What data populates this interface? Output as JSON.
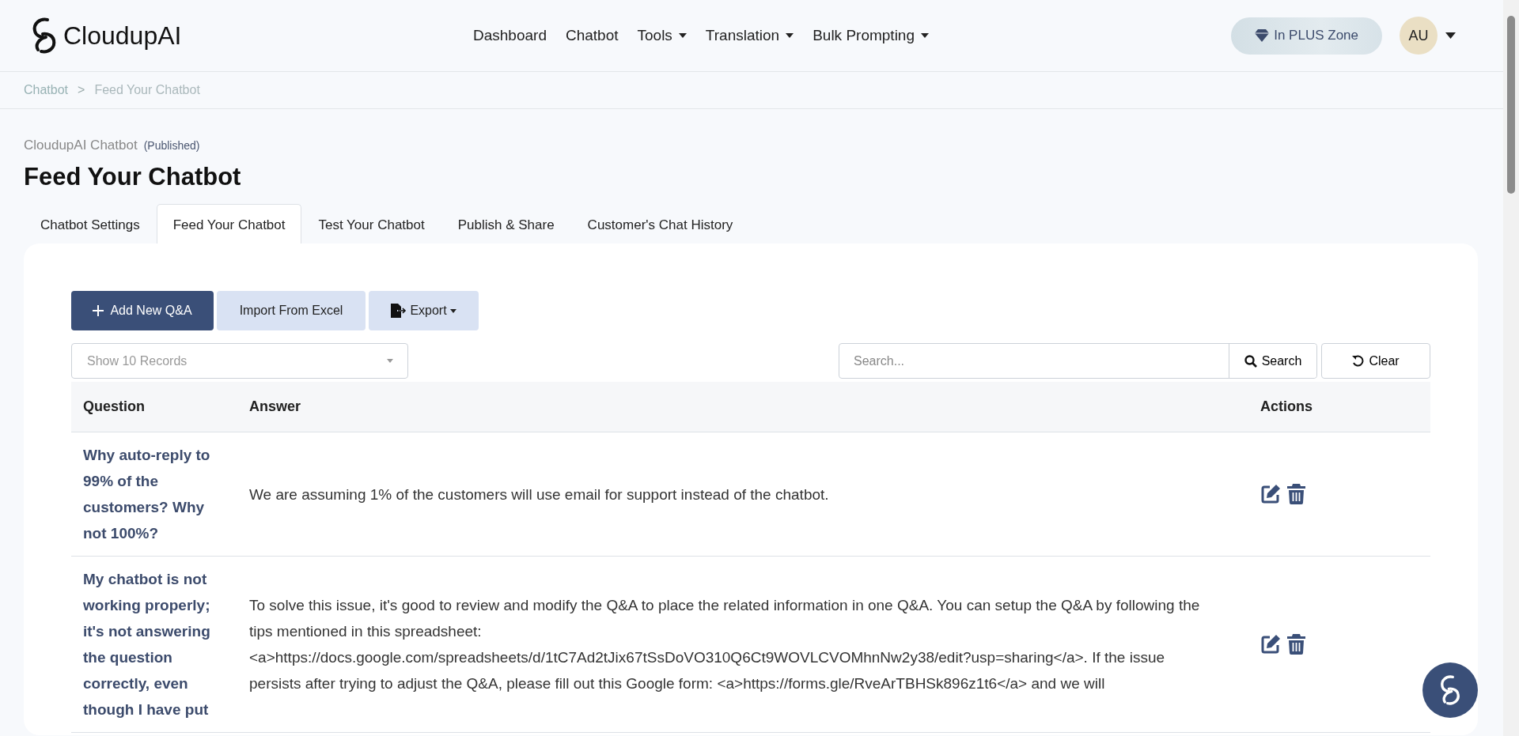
{
  "brand": {
    "name": "CloudupAI"
  },
  "nav": [
    {
      "label": "Dashboard",
      "kind": "link"
    },
    {
      "label": "Chatbot",
      "kind": "link"
    },
    {
      "label": "Tools",
      "kind": "dropdown"
    },
    {
      "label": "Translation",
      "kind": "dropdown"
    },
    {
      "label": "Bulk Prompting",
      "kind": "dropdown"
    }
  ],
  "plus_badge": {
    "label": "In PLUS Zone"
  },
  "avatar": {
    "initials": "AU"
  },
  "breadcrumb": {
    "items": [
      "Chatbot",
      "Feed Your Chatbot"
    ],
    "separator": ">"
  },
  "chatbot": {
    "name": "CloudupAI Chatbot",
    "status": "(Published)"
  },
  "page_title": "Feed Your Chatbot",
  "tabs": [
    {
      "label": "Chatbot Settings",
      "selected": false
    },
    {
      "label": "Feed Your Chatbot",
      "selected": true
    },
    {
      "label": "Test Your Chatbot",
      "selected": false
    },
    {
      "label": "Publish & Share",
      "selected": false
    },
    {
      "label": "Customer's Chat History",
      "selected": false
    }
  ],
  "toolbar": [
    {
      "kind": "primary",
      "label": "Add New Q&A"
    },
    {
      "kind": "secondary",
      "label": "Import From Excel"
    },
    {
      "kind": "dropdown",
      "label": "Export"
    }
  ],
  "records_select": {
    "placeholder": "Show 10 Records"
  },
  "search": {
    "placeholder": "Search...",
    "button": "Search",
    "clear": "Clear"
  },
  "table": {
    "columns": [
      "Question",
      "Answer",
      "Actions"
    ],
    "rows": [
      {
        "question": "Why auto-reply to 99% of the customers? Why not 100%?",
        "answer": "We are assuming 1% of the customers will use email for support instead of the chatbot."
      },
      {
        "question": "My chatbot is not working properly; it's not answering the question correctly, even though I have put",
        "answer": "To solve this issue, it's good to review and modify the Q&A to place the related information in one Q&A. You can setup the Q&A by following the tips mentioned in this spreadsheet: <a>https://docs.google.com/spreadsheets/d/1tC7Ad2tJix67tSsDoVO310Q6Ct9WOVLCVOMhnNw2y38/edit?usp=sharing</a>. If the issue persists after trying to adjust the Q&A, please fill out this Google form: <a>https://forms.gle/RveArTBHSk896z1t6</a> and we will"
      }
    ]
  }
}
